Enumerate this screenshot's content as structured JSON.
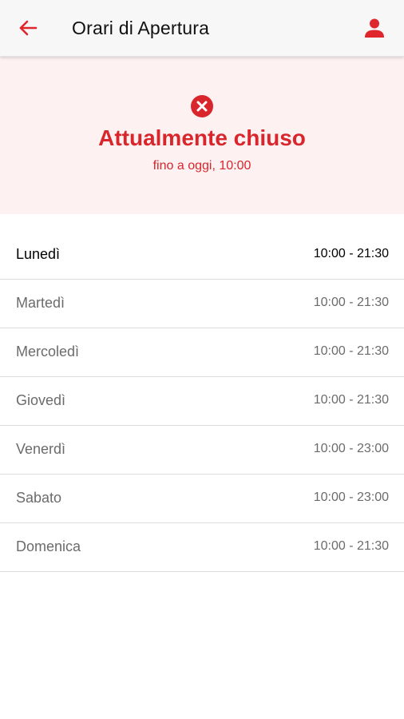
{
  "header": {
    "title": "Orari di Apertura",
    "back_icon": "arrow-left-icon",
    "profile_icon": "user-icon",
    "accent_color": "#e0262d"
  },
  "status": {
    "icon": "close-circle-icon",
    "title": "Attualmente chiuso",
    "subtitle": "fino a oggi, 10:00",
    "color": "#d9262c",
    "background": "#fdf1f2"
  },
  "days": [
    {
      "name": "Lunedì",
      "hours": "10:00 - 21:30",
      "today": true
    },
    {
      "name": "Martedì",
      "hours": "10:00 - 21:30",
      "today": false
    },
    {
      "name": "Mercoledì",
      "hours": "10:00 - 21:30",
      "today": false
    },
    {
      "name": "Giovedì",
      "hours": "10:00 - 21:30",
      "today": false
    },
    {
      "name": "Venerdì",
      "hours": "10:00 - 23:00",
      "today": false
    },
    {
      "name": "Sabato",
      "hours": "10:00 - 23:00",
      "today": false
    },
    {
      "name": "Domenica",
      "hours": "10:00 - 21:30",
      "today": false
    }
  ]
}
